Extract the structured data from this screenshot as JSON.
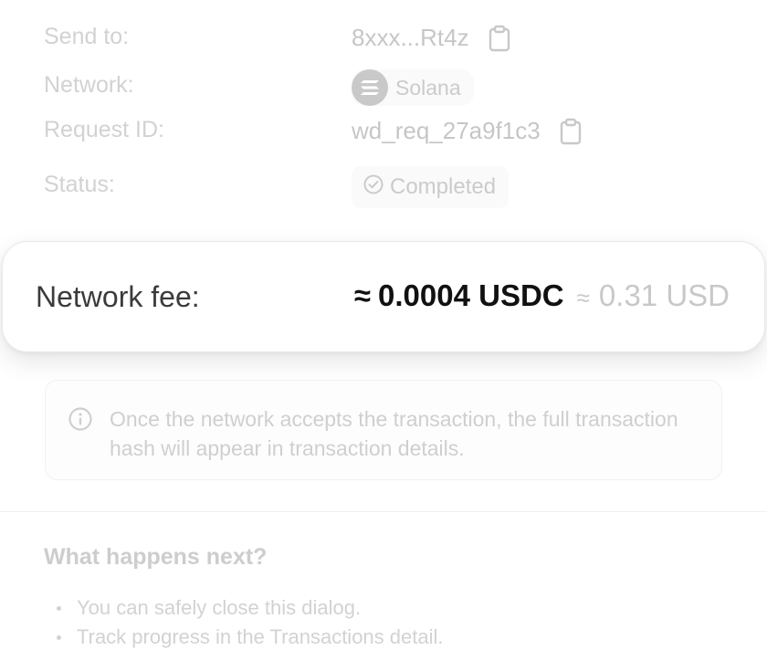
{
  "details": {
    "send_to_label": "Send to:",
    "send_to_value": "8xxx...Rt4z",
    "network_label": "Network:",
    "network_value": "Solana",
    "request_id_label": "Request ID:",
    "request_id_value": "wd_req_27a9f1c3",
    "status_label": "Status:",
    "status_value": "Completed"
  },
  "fee": {
    "label": "Network fee:",
    "approx_symbol": "≈",
    "amount": "0.0004 USDC",
    "approx_symbol_secondary": "≈",
    "fiat": "0.31 USD"
  },
  "notice": {
    "text": "Once the network accepts the transaction, the full transaction hash will appear in transaction details."
  },
  "next_steps": {
    "title": "What happens next?",
    "items": [
      "You can safely close this dialog.",
      "Track progress in the Transactions detail."
    ]
  },
  "colors": {
    "muted_text": "#d2d2d2",
    "primary_text": "#111111",
    "card_border": "#e8e8e8"
  },
  "icons": {
    "copy": "clipboard-icon",
    "network": "solana-logo-icon",
    "status": "check-circle-icon",
    "info": "info-icon"
  }
}
